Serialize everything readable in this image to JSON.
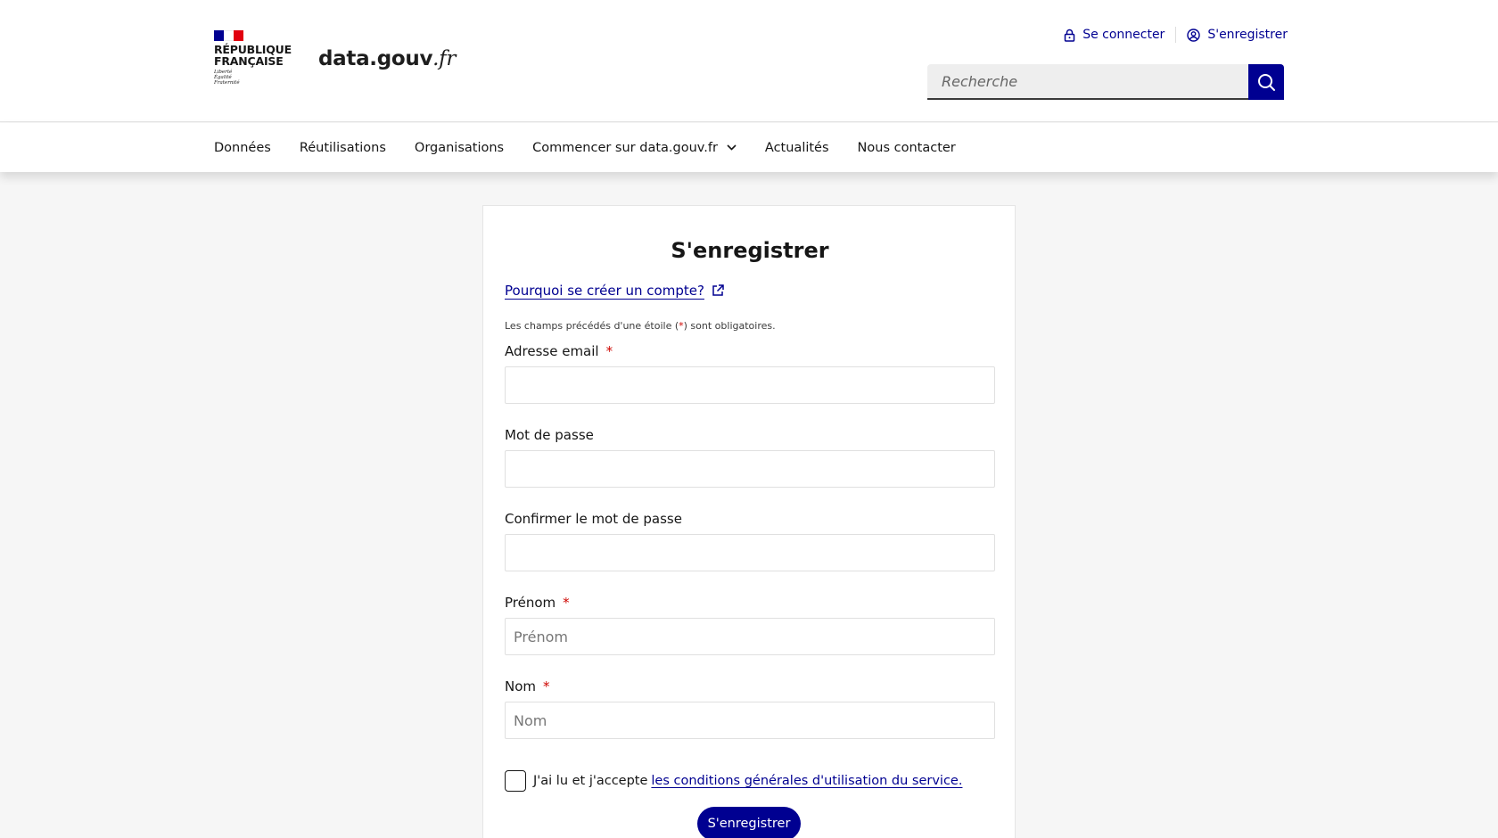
{
  "header": {
    "republique_line1": "RÉPUBLIQUE",
    "republique_line2": "FRANÇAISE",
    "motto_1": "Liberté",
    "motto_2": "Égalité",
    "motto_3": "Fraternité",
    "site_name_main": "data.gouv",
    "site_name_tld": ".fr",
    "login_label": "Se connecter",
    "register_label": "S'enregistrer",
    "search_placeholder": "Recherche"
  },
  "nav": {
    "items": [
      "Données",
      "Réutilisations",
      "Organisations",
      "Commencer sur data.gouv.fr",
      "Actualités",
      "Nous contacter"
    ]
  },
  "form": {
    "title": "S'enregistrer",
    "why_link": "Pourquoi se créer un compte?",
    "hint_before": "Les champs précédés d'une étoile (",
    "hint_star": "*",
    "hint_after": ") sont obligatoires.",
    "required_mark": "*",
    "email_label": "Adresse email",
    "password_label": "Mot de passe",
    "confirm_label": "Confirmer le mot de passe",
    "firstname_label": "Prénom",
    "firstname_placeholder": "Prénom",
    "lastname_label": "Nom",
    "lastname_placeholder": "Nom",
    "terms_text": "J'ai lu et j'accepte",
    "terms_link": "les conditions générales d'utilisation du service.",
    "submit_label": "S'enregistrer"
  },
  "colors": {
    "primary": "#000091",
    "required": "#ce0500"
  }
}
